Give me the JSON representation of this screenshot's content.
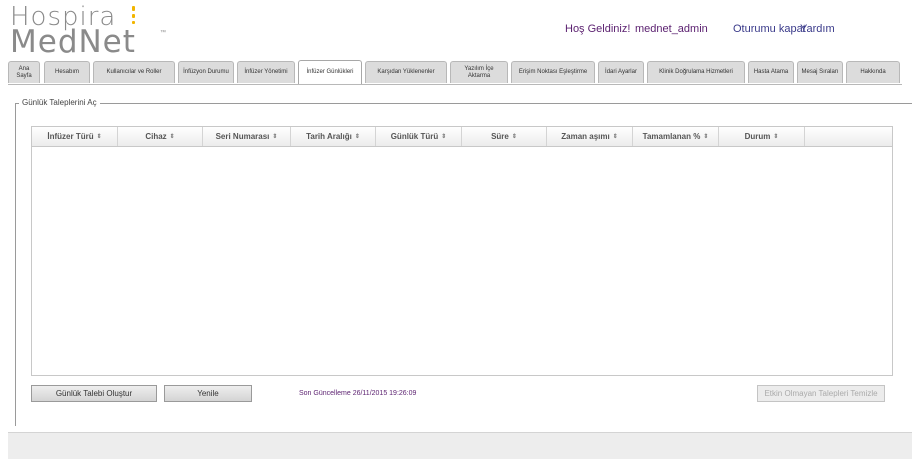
{
  "logo": {
    "line1": "Hospira",
    "line2": "MedNet",
    "tm": "™"
  },
  "header": {
    "welcome": "Hoş Geldiniz!",
    "username": "mednet_admin",
    "logout": "Oturumu kapat",
    "help": "Yardım"
  },
  "tabs": [
    {
      "label": "Ana Sayfa",
      "active": false
    },
    {
      "label": "Hesabım",
      "active": false
    },
    {
      "label": "Kullanıcılar ve Roller",
      "active": false
    },
    {
      "label": "İnfüzyon Durumu",
      "active": false
    },
    {
      "label": "İnfüzer Yönetimi",
      "active": false
    },
    {
      "label": "İnfüzer Günlükleri",
      "active": true
    },
    {
      "label": "Karşıdan Yüklenenler",
      "active": false
    },
    {
      "label": "Yazılım İçe Aktarma",
      "active": false
    },
    {
      "label": "Erişim Noktası Eşleştirme",
      "active": false
    },
    {
      "label": "İdari Ayarlar",
      "active": false
    },
    {
      "label": "Klinik Doğrulama Hizmetleri",
      "active": false
    },
    {
      "label": "Hasta Atama",
      "active": false
    },
    {
      "label": "Mesaj Sıraları",
      "active": false
    },
    {
      "label": "Hakkında",
      "active": false
    }
  ],
  "panel": {
    "legend": "Günlük Taleplerini Aç",
    "columns": [
      "İnfüzer Türü",
      "Cihaz",
      "Seri Numarası",
      "Tarih Aralığı",
      "Günlük Türü",
      "Süre",
      "Zaman aşımı",
      "Tamamlanan %",
      "Durum"
    ],
    "sort_glyph": "⇕",
    "rows": []
  },
  "actions": {
    "create": "Günlük Talebi Oluştur",
    "refresh": "Yenile",
    "last_updated": "Son Güncelleme 26/11/2015 19:26:09",
    "clear_inactive": "Etkin Olmayan Talepleri Temizle"
  },
  "colors": {
    "accent": "#5a1f6f",
    "logo_gray": "#8a8a8a",
    "logo_yellow": "#f2b500"
  }
}
